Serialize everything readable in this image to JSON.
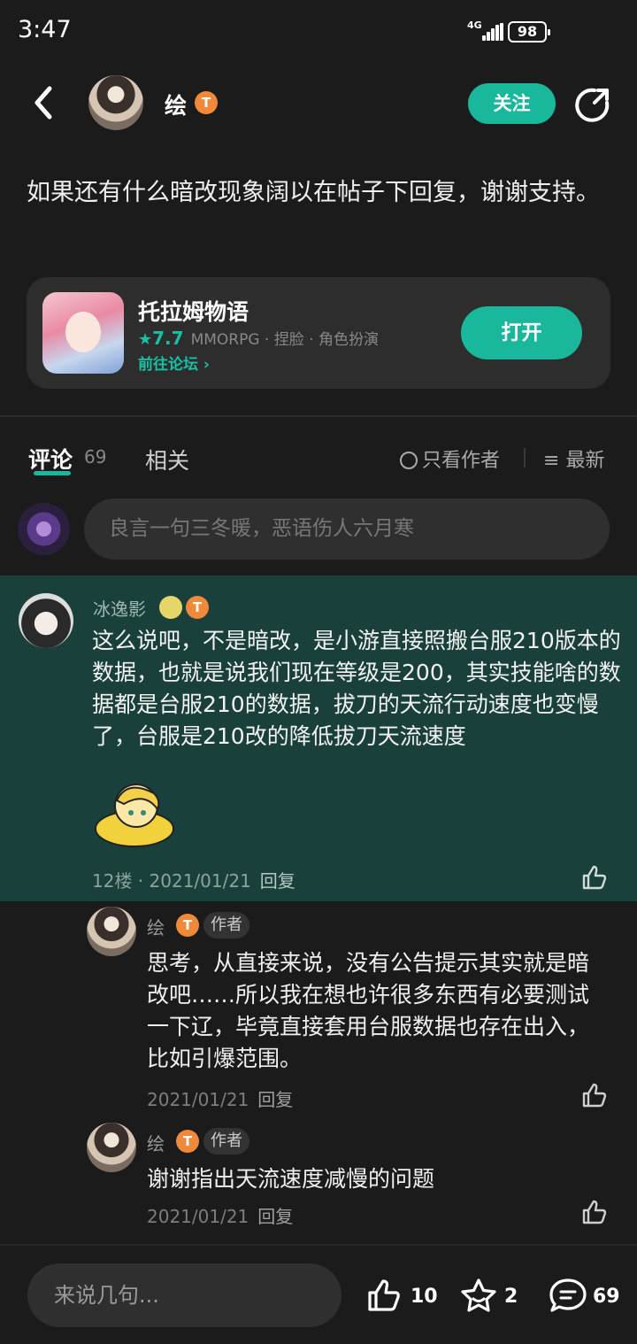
{
  "status_bar": {
    "time": "3:47",
    "network": "4G",
    "battery": "98"
  },
  "header": {
    "author_name": "绘",
    "author_level": "T",
    "follow_label": "关注"
  },
  "post": {
    "text": "如果还有什么暗改现象阔以在帖子下回复，谢谢支持。"
  },
  "game_card": {
    "name": "托拉姆物语",
    "rating": "7.7",
    "tags": "MMORPG · 捏脸 · 角色扮演",
    "forum_link": "前往论坛",
    "open_label": "打开"
  },
  "tabs": {
    "comments_label": "评论",
    "comments_count": "69",
    "related_label": "相关",
    "only_author_label": "只看作者",
    "sort_label": "最新"
  },
  "comment_input": {
    "placeholder": "良言一句三冬暖，恶语伤人六月寒"
  },
  "highlight_comment": {
    "user": "冰逸影",
    "level": "T",
    "text": "这么说吧，不是暗改，是小游直接照搬台服210版本的数据，也就是说我们现在等级是200，其实技能啥的数据都是台服210的数据，拔刀的天流行动速度也变慢了，台服是210改的降低拔刀天流速度",
    "floor_date": "12楼 · 2021/01/21",
    "reply_label": "回复"
  },
  "replies": [
    {
      "user": "绘",
      "level": "T",
      "tag": "作者",
      "text": "思考，从直接来说，没有公告提示其实就是暗改吧……所以我在想也许很多东西有必要测试一下辽，毕竟直接套用台服数据也存在出入，比如引爆范围。",
      "date": "2021/01/21",
      "reply_label": "回复"
    },
    {
      "user": "绘",
      "level": "T",
      "tag": "作者",
      "text": "谢谢指出天流速度减慢的问题",
      "date": "2021/01/21",
      "reply_label": "回复"
    }
  ],
  "bottom_bar": {
    "input_placeholder": "来说几句...",
    "likes": "10",
    "favorites": "2",
    "comments": "69"
  },
  "colors": {
    "accent": "#19b89d",
    "highlight_bg": "#19403a",
    "level_badge": "#f08a3a"
  }
}
